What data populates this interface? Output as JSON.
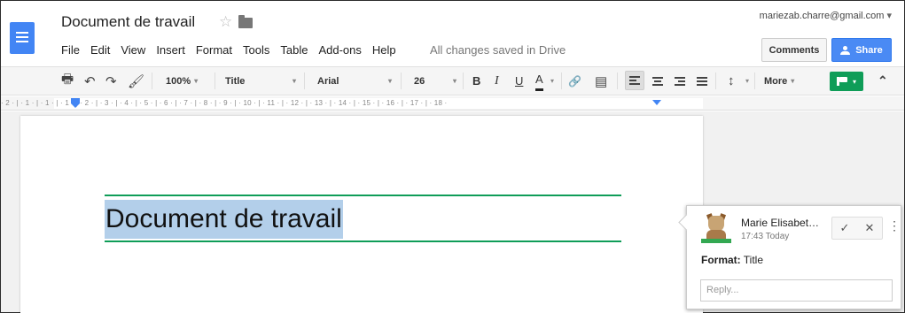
{
  "header": {
    "doc_title": "Document de travail",
    "star": "☆",
    "user_email": "mariezab.charre@gmail.com",
    "save_status": "All changes saved in Drive",
    "comments_label": "Comments",
    "share_label": "Share"
  },
  "menu": [
    "File",
    "Edit",
    "View",
    "Insert",
    "Format",
    "Tools",
    "Table",
    "Add-ons",
    "Help"
  ],
  "toolbar": {
    "print": "🖶",
    "undo": "↶",
    "redo": "↷",
    "paint": "🖌",
    "zoom": "100%",
    "style": "Title",
    "font": "Arial",
    "size": "26",
    "bold": "B",
    "italic": "I",
    "underline": "U",
    "text_color": "A",
    "link": "🔗",
    "comment": "▤",
    "line_spacing": "↕",
    "more": "More",
    "collapse": "⌃",
    "caret": "▾"
  },
  "ruler": {
    "text": "· 2 · | · 1 · | · 1 · | · 1 · | · 2 · | · 3 · | · 4 · | · 5 · | · 6 · | · 7 · | · 8 · | · 9 · | · 10 · | · 11 · | · 12 · | · 13 · | · 14 · | · 15 · | · 16 · | · 17 · | · 18 ·"
  },
  "document": {
    "title_text": "Document de travail"
  },
  "comment": {
    "author": "Marie Elisabet…",
    "time": "17:43 Today",
    "resolve": "✓",
    "close": "✕",
    "more": "⋮",
    "format_label": "Format:",
    "format_value": "Title",
    "reply_placeholder": "Reply..."
  },
  "colors": {
    "accent_blue": "#4285f4",
    "share_blue": "#4a8af4",
    "green": "#0f9d58",
    "selection": "#b3cfea"
  }
}
